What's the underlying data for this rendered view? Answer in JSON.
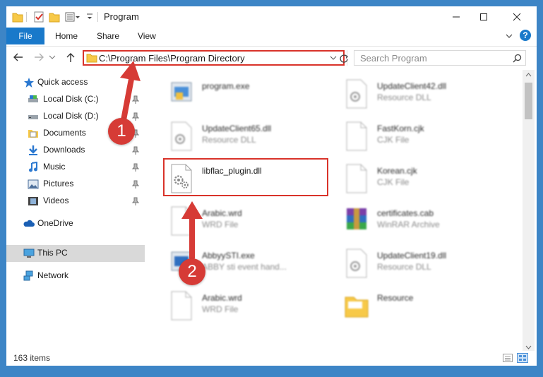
{
  "window": {
    "title": "Program"
  },
  "ribbon": {
    "tabs": [
      "File",
      "Home",
      "Share",
      "View"
    ]
  },
  "address": {
    "path": "C:\\Program Files\\Program Directory"
  },
  "search": {
    "placeholder": "Search Program"
  },
  "nav": {
    "items": [
      {
        "label": "Quick access",
        "icon": "star-icon"
      },
      {
        "label": "Local Disk (C:)",
        "icon": "drive-icon",
        "pinned": true
      },
      {
        "label": "Local Disk (D:)",
        "icon": "drive-icon",
        "pinned": true
      },
      {
        "label": "Documents",
        "icon": "documents-icon",
        "pinned": true
      },
      {
        "label": "Downloads",
        "icon": "downloads-icon",
        "pinned": true
      },
      {
        "label": "Music",
        "icon": "music-icon",
        "pinned": true
      },
      {
        "label": "Pictures",
        "icon": "pictures-icon",
        "pinned": true
      },
      {
        "label": "Videos",
        "icon": "videos-icon",
        "pinned": true
      },
      {
        "label": "OneDrive",
        "icon": "cloud-icon"
      },
      {
        "label": "This PC",
        "icon": "computer-icon",
        "selected": true
      },
      {
        "label": "Network",
        "icon": "network-icon"
      }
    ]
  },
  "files": [
    {
      "name": "program.exe",
      "type": ""
    },
    {
      "name": "UpdateClient42.dll",
      "type": "Resource DLL"
    },
    {
      "name": "UpdateClient65.dll",
      "type": "Resource DLL"
    },
    {
      "name": "FastKorn.cjk",
      "type": "CJK File"
    },
    {
      "name": "libflac_plugin.dll",
      "type": ""
    },
    {
      "name": "Korean.cjk",
      "type": "CJK File"
    },
    {
      "name": "Arabic.wrd",
      "type": "WRD File"
    },
    {
      "name": "certificates.cab",
      "type": "WinRAR Archive"
    },
    {
      "name": "AbbyySTI.exe",
      "type": "ABBY sti event hand..."
    },
    {
      "name": "UpdateClient19.dll",
      "type": "Resource DLL"
    },
    {
      "name": "Arabic.wrd",
      "type": "WRD File"
    },
    {
      "name": "Resource",
      "type": ""
    }
  ],
  "status": {
    "item_count": "163 items"
  },
  "annotations": {
    "step1": "1",
    "step2": "2"
  },
  "colors": {
    "accent": "#1979ca",
    "highlight": "#d9332a",
    "selected": "#d9d9d9",
    "desktop": "#3d85c6"
  }
}
